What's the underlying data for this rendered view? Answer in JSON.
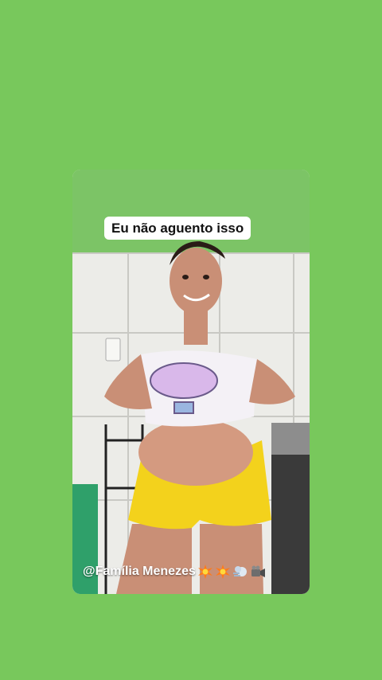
{
  "story": {
    "caption": "Eu não aguento isso",
    "mention": "@Família Menezes",
    "stickers": [
      "explosion-icon",
      "explosion-icon",
      "dash-icon",
      "video-camera-icon"
    ]
  },
  "colors": {
    "background": "#78c85c",
    "wall_top": "#7cc466",
    "tiles": "#ecece8",
    "shorts": "#f3d21c",
    "caption_bg": "#ffffff"
  }
}
